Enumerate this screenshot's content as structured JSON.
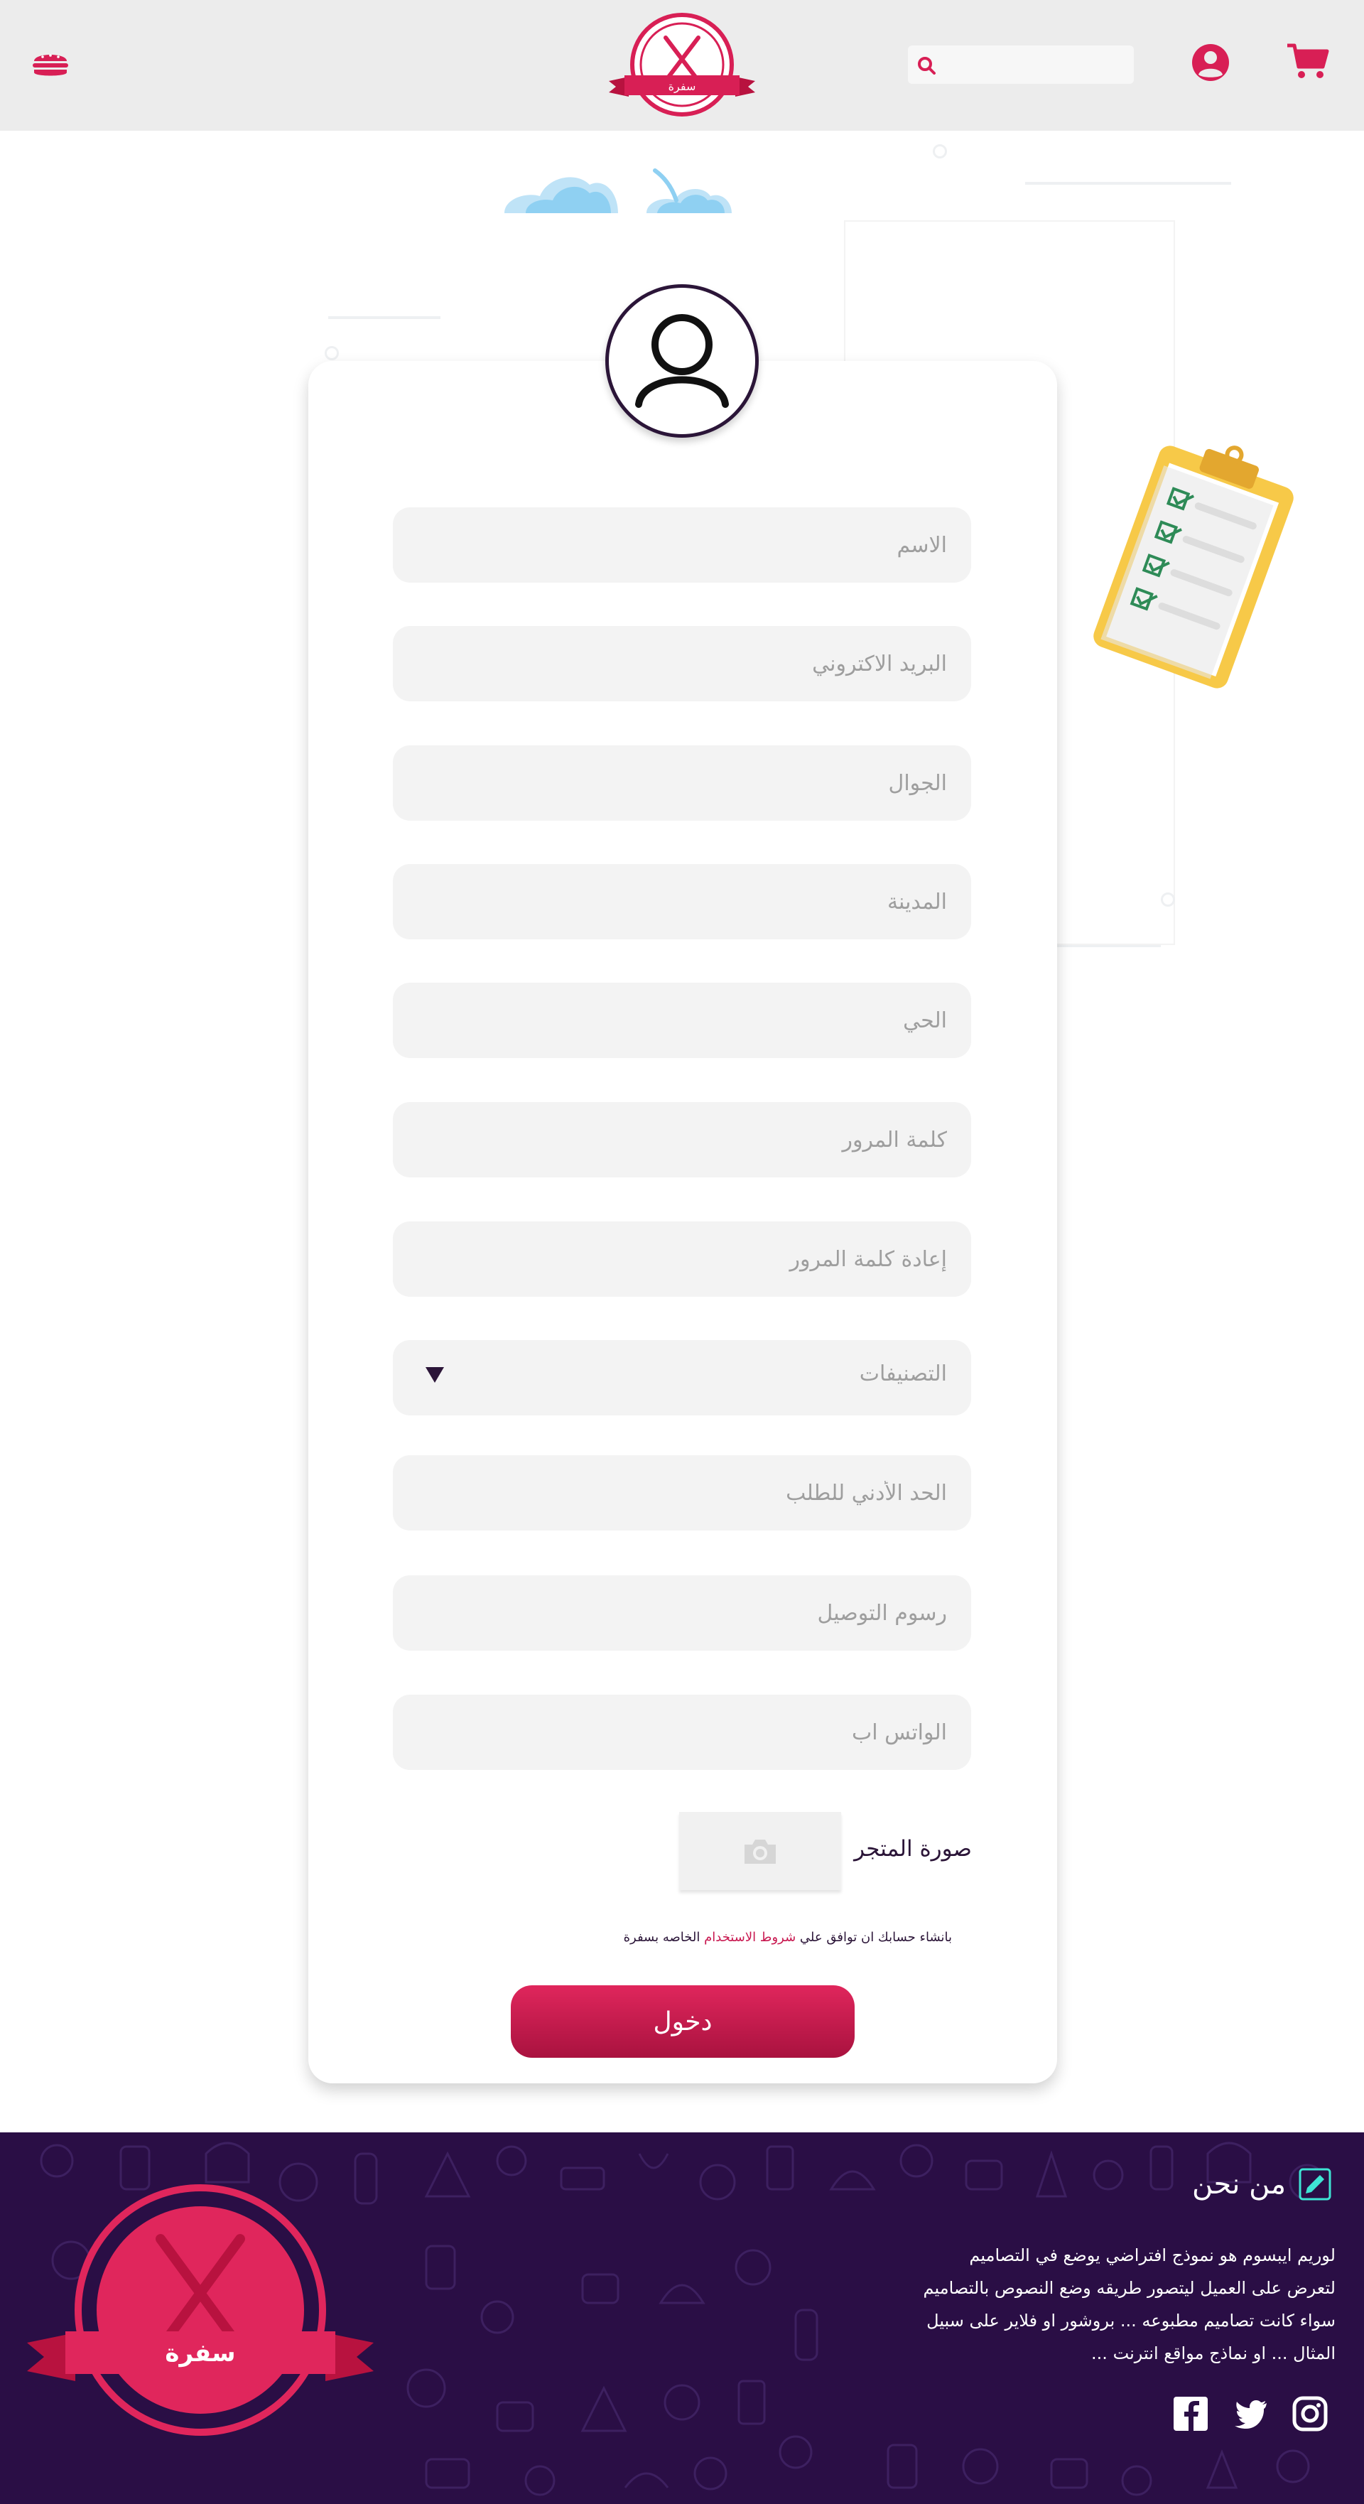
{
  "brand": {
    "logo_text": "سفرة",
    "primary_color": "#d81f55",
    "dark_color": "#2a0e45"
  },
  "header": {
    "menu_icon": "hamburger-food-icon",
    "search": {
      "placeholder": "",
      "icon": "search-icon"
    },
    "user_icon": "user-circle-icon",
    "cart_icon": "cart-icon"
  },
  "form": {
    "fields": [
      {
        "placeholder": "الاسم"
      },
      {
        "placeholder": "البريد الاكتروني"
      },
      {
        "placeholder": "الجوال"
      },
      {
        "placeholder": "المدينة"
      },
      {
        "placeholder": "الحي"
      },
      {
        "placeholder": "كلمة المرور"
      },
      {
        "placeholder": "إعادة كلمة المرور"
      }
    ],
    "category_select": {
      "placeholder": "التصنيفات"
    },
    "extra_fields": [
      {
        "placeholder": "الحد الأدني للطلب"
      },
      {
        "placeholder": "رسوم التوصيل"
      },
      {
        "placeholder": "الواتس اب"
      }
    ],
    "store_image_label": "صورة المتجر",
    "terms_prefix": "بانشاء حسابك ان توافق علي",
    "terms_link": "شروط الاستخدام",
    "terms_suffix": "الخاصه بسفرة",
    "submit_label": "دخول"
  },
  "footer": {
    "about_title": "من نحن",
    "about_lines": [
      "لوريم ايبسوم هو نموذج افتراضي يوضع في التصاميم",
      "لتعرض على العميل ليتصور طريقه وضع النصوص بالتصاميم",
      "سواء كانت تصاميم مطبوعه ... بروشور او فلاير على سبيل",
      "المثال ... او نماذج مواقع انترنت ..."
    ],
    "social": [
      "facebook-icon",
      "twitter-icon",
      "instagram-icon"
    ]
  }
}
